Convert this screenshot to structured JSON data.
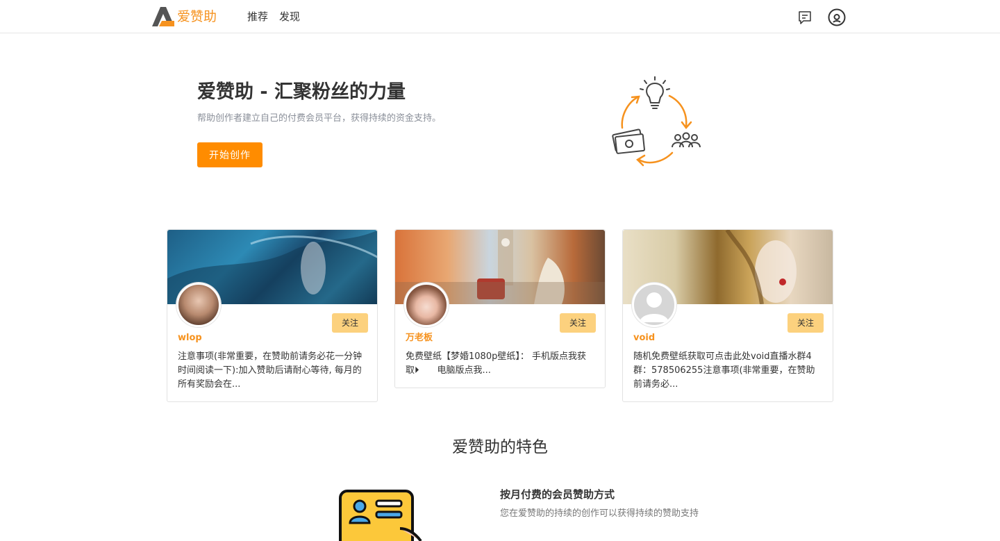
{
  "header": {
    "logo_text": "爱赞助",
    "nav": [
      {
        "label": "推荐"
      },
      {
        "label": "发现"
      }
    ],
    "icons": [
      "message-icon",
      "user-circle-icon"
    ]
  },
  "hero": {
    "title": "爱赞助 - 汇聚粉丝的力量",
    "subtitle": "帮助创作者建立自己的付费会员平台，获得持续的资金支持。",
    "cta_label": "开始创作"
  },
  "cards": [
    {
      "name": "wlop",
      "follow_label": "关注",
      "description": "注意事项(非常重要，在赞助前请务必花一分钟时间阅读一下):加入赞助后请耐心等待, 每月的所有奖励会在..."
    },
    {
      "name": "万老板",
      "follow_label": "关注",
      "description": "免费壁纸【梦婚1080p壁纸】： 手机版点我获取⏵　　电脑版点我..."
    },
    {
      "name": "void",
      "follow_label": "关注",
      "description": "随机免费壁纸获取可点击此处void直播水群4群：578506255注意事项(非常重要，在赞助前请务必..."
    }
  ],
  "features": {
    "title": "爱赞助的特色",
    "items": [
      {
        "heading": "按月付费的会员赞助方式",
        "text": "您在爱赞助的持续的创作可以获得持续的赞助支持"
      }
    ]
  },
  "colors": {
    "brand": "#f6921e",
    "cta": "#ff8c00",
    "follow": "#fcd17e"
  }
}
